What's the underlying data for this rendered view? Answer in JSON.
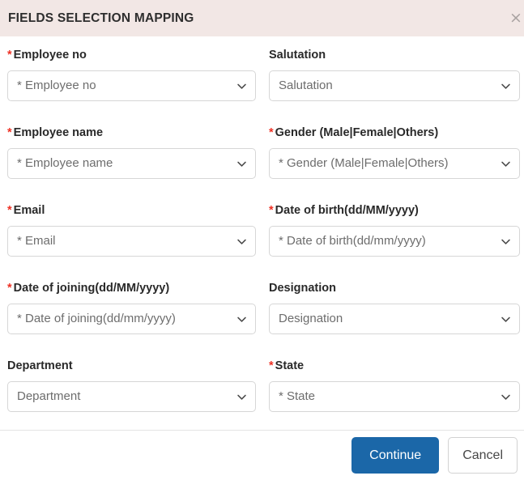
{
  "dialog": {
    "title": "FIELDS SELECTION MAPPING",
    "close_icon": "close-icon",
    "close_glyph": "×",
    "header_bg": "#f2e7e5",
    "required_marker": "*",
    "required_color": "#ee3124"
  },
  "fields": [
    {
      "label": "Employee no",
      "required": true,
      "value": "* Employee no",
      "column": "left"
    },
    {
      "label": "Salutation",
      "required": false,
      "value": "Salutation",
      "column": "right"
    },
    {
      "label": "Employee name",
      "required": true,
      "value": "* Employee name",
      "column": "left"
    },
    {
      "label": "Gender (Male|Female|Others)",
      "required": true,
      "value": "* Gender (Male|Female|Others)",
      "column": "right"
    },
    {
      "label": "Email",
      "required": true,
      "value": "* Email",
      "column": "left"
    },
    {
      "label": "Date of birth(dd/MM/yyyy)",
      "required": true,
      "value": "* Date of birth(dd/mm/yyyy)",
      "column": "right"
    },
    {
      "label": "Date of joining(dd/MM/yyyy)",
      "required": true,
      "value": "* Date of joining(dd/mm/yyyy)",
      "column": "left"
    },
    {
      "label": "Designation",
      "required": false,
      "value": "Designation",
      "column": "right"
    },
    {
      "label": "Department",
      "required": false,
      "value": "Department",
      "column": "left"
    },
    {
      "label": "State",
      "required": true,
      "value": "* State",
      "column": "right"
    }
  ],
  "footer": {
    "continue_label": "Continue",
    "cancel_label": "Cancel",
    "primary_color": "#1b67a8"
  }
}
